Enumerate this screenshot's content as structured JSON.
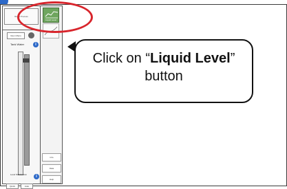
{
  "left_panel": {
    "top_button_label": "Reset Process",
    "small_button_label": "Open Menu",
    "tank_label": "Tank Water",
    "bottom_label": "Level Stabilization",
    "bottom_buttons": [
      "Quick",
      "Auto"
    ]
  },
  "middle_panel": {
    "thumbnail_label": "Liquid Level",
    "bottom_items": [
      "Info",
      "Data",
      "Help"
    ]
  },
  "callout": {
    "prefix": "Click on “",
    "bold": "Liquid Level",
    "suffix": "”",
    "line2": "button"
  },
  "colors": {
    "highlight": "#d8252c",
    "liquid_button": "#6ea55e",
    "info_icon": "#2d69c8"
  }
}
